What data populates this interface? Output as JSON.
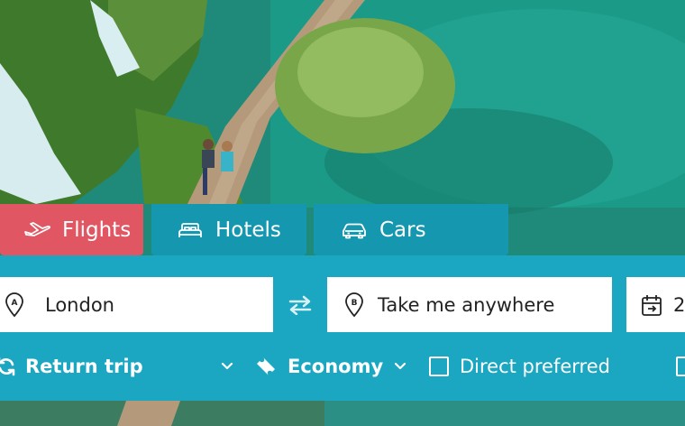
{
  "tabs": [
    {
      "label": "Flights",
      "icon": "plane-icon",
      "active": true
    },
    {
      "label": "Hotels",
      "icon": "bed-icon",
      "active": false
    },
    {
      "label": "Cars",
      "icon": "car-icon",
      "active": false
    }
  ],
  "search": {
    "origin": {
      "value": "London",
      "icon": "pin-a-icon"
    },
    "destination": {
      "value": "Take me anywhere",
      "icon": "pin-b-icon"
    },
    "date": {
      "value": "2",
      "icon": "calendar-icon"
    },
    "swap_icon": "swap-arrows-icon"
  },
  "options": {
    "trip_type": "Return trip",
    "cabin_class": "Economy",
    "direct_label": "Direct preferred",
    "direct_checked": false
  },
  "colors": {
    "active_tab": "#e05662",
    "inactive_tab": "#1697b0",
    "panel": "#1ba6c1",
    "field_bg": "#ffffff"
  }
}
